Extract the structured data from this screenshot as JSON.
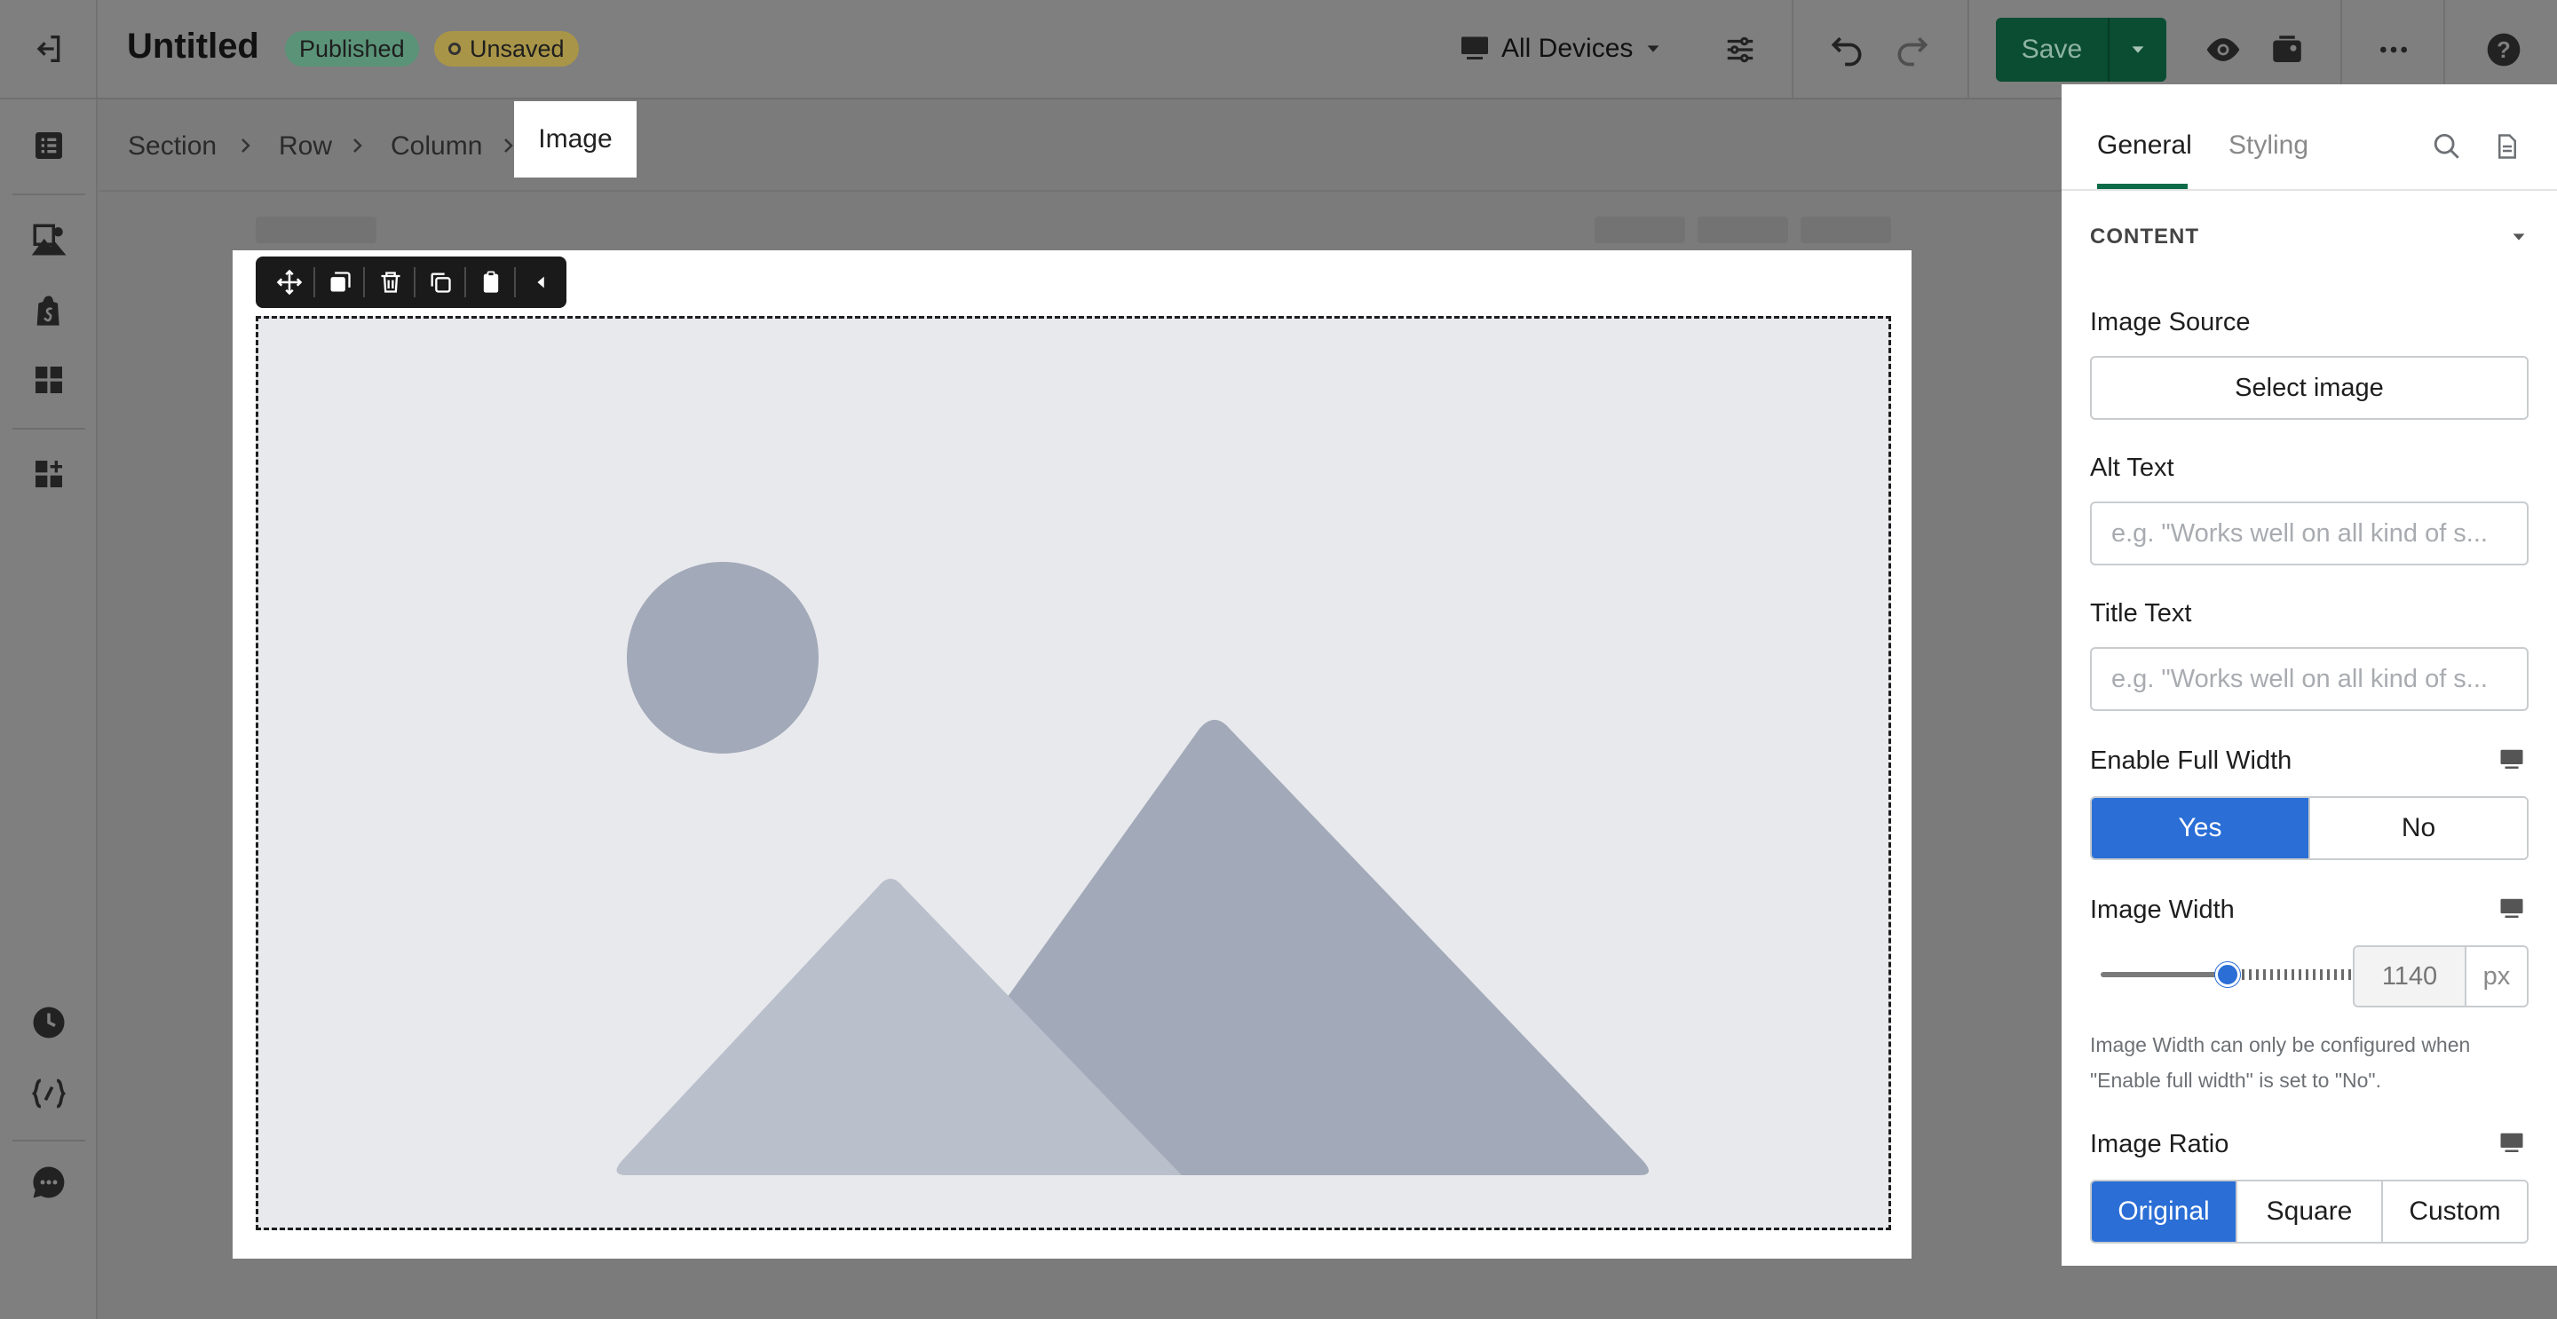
{
  "header": {
    "title": "Untitled",
    "badge_published": "Published",
    "badge_unsaved": "Unsaved",
    "devices_label": "All Devices",
    "save_label": "Save",
    "icons": [
      "exit-icon",
      "monitor-icon",
      "caret-down-icon",
      "sliders-icon",
      "undo-icon",
      "redo-icon",
      "eye-icon",
      "media-icon",
      "more-icon",
      "help-icon"
    ]
  },
  "sidebar": {
    "icons": [
      "layers-icon",
      "image-library-icon",
      "shopify-icon",
      "dashboard-icon",
      "add-section-icon",
      "history-icon",
      "code-icon",
      "chat-icon"
    ]
  },
  "breadcrumb": {
    "items": [
      "Section",
      "Row",
      "Column",
      "Image"
    ]
  },
  "canvas": {
    "toolbar_icons": [
      "move-icon",
      "duplicate-icon",
      "delete-icon",
      "copy-icon",
      "paste-icon",
      "collapse-left-icon"
    ],
    "image_placeholder": "image-placeholder-icon"
  },
  "panel": {
    "tabs": [
      "General",
      "Styling"
    ],
    "active_tab": "General",
    "section_title": "CONTENT",
    "image_source_label": "Image Source",
    "select_image_label": "Select image",
    "alt_text_label": "Alt Text",
    "alt_text_placeholder": "e.g. \"Works well on all kind of s...",
    "title_text_label": "Title Text",
    "title_text_placeholder": "e.g. \"Works well on all kind of s...",
    "full_width_label": "Enable Full Width",
    "full_width_options": [
      "Yes",
      "No"
    ],
    "full_width_selected": "Yes",
    "image_width_label": "Image Width",
    "image_width_value": "1140",
    "image_width_unit": "px",
    "image_width_slider_fraction": 0.5,
    "image_width_help": "Image Width can only be configured when \"Enable full width\" is set to \"No\".",
    "image_ratio_label": "Image Ratio",
    "image_ratio_options": [
      "Original",
      "Square",
      "Custom"
    ],
    "image_ratio_selected": "Original"
  },
  "colors": {
    "accent_blue": "#2a6ed6",
    "save_green": "#0b4d33",
    "tab_underline": "#0d6b49",
    "placeholder_bg": "#e8e9ed",
    "placeholder_shape": "#a2a9b8"
  }
}
